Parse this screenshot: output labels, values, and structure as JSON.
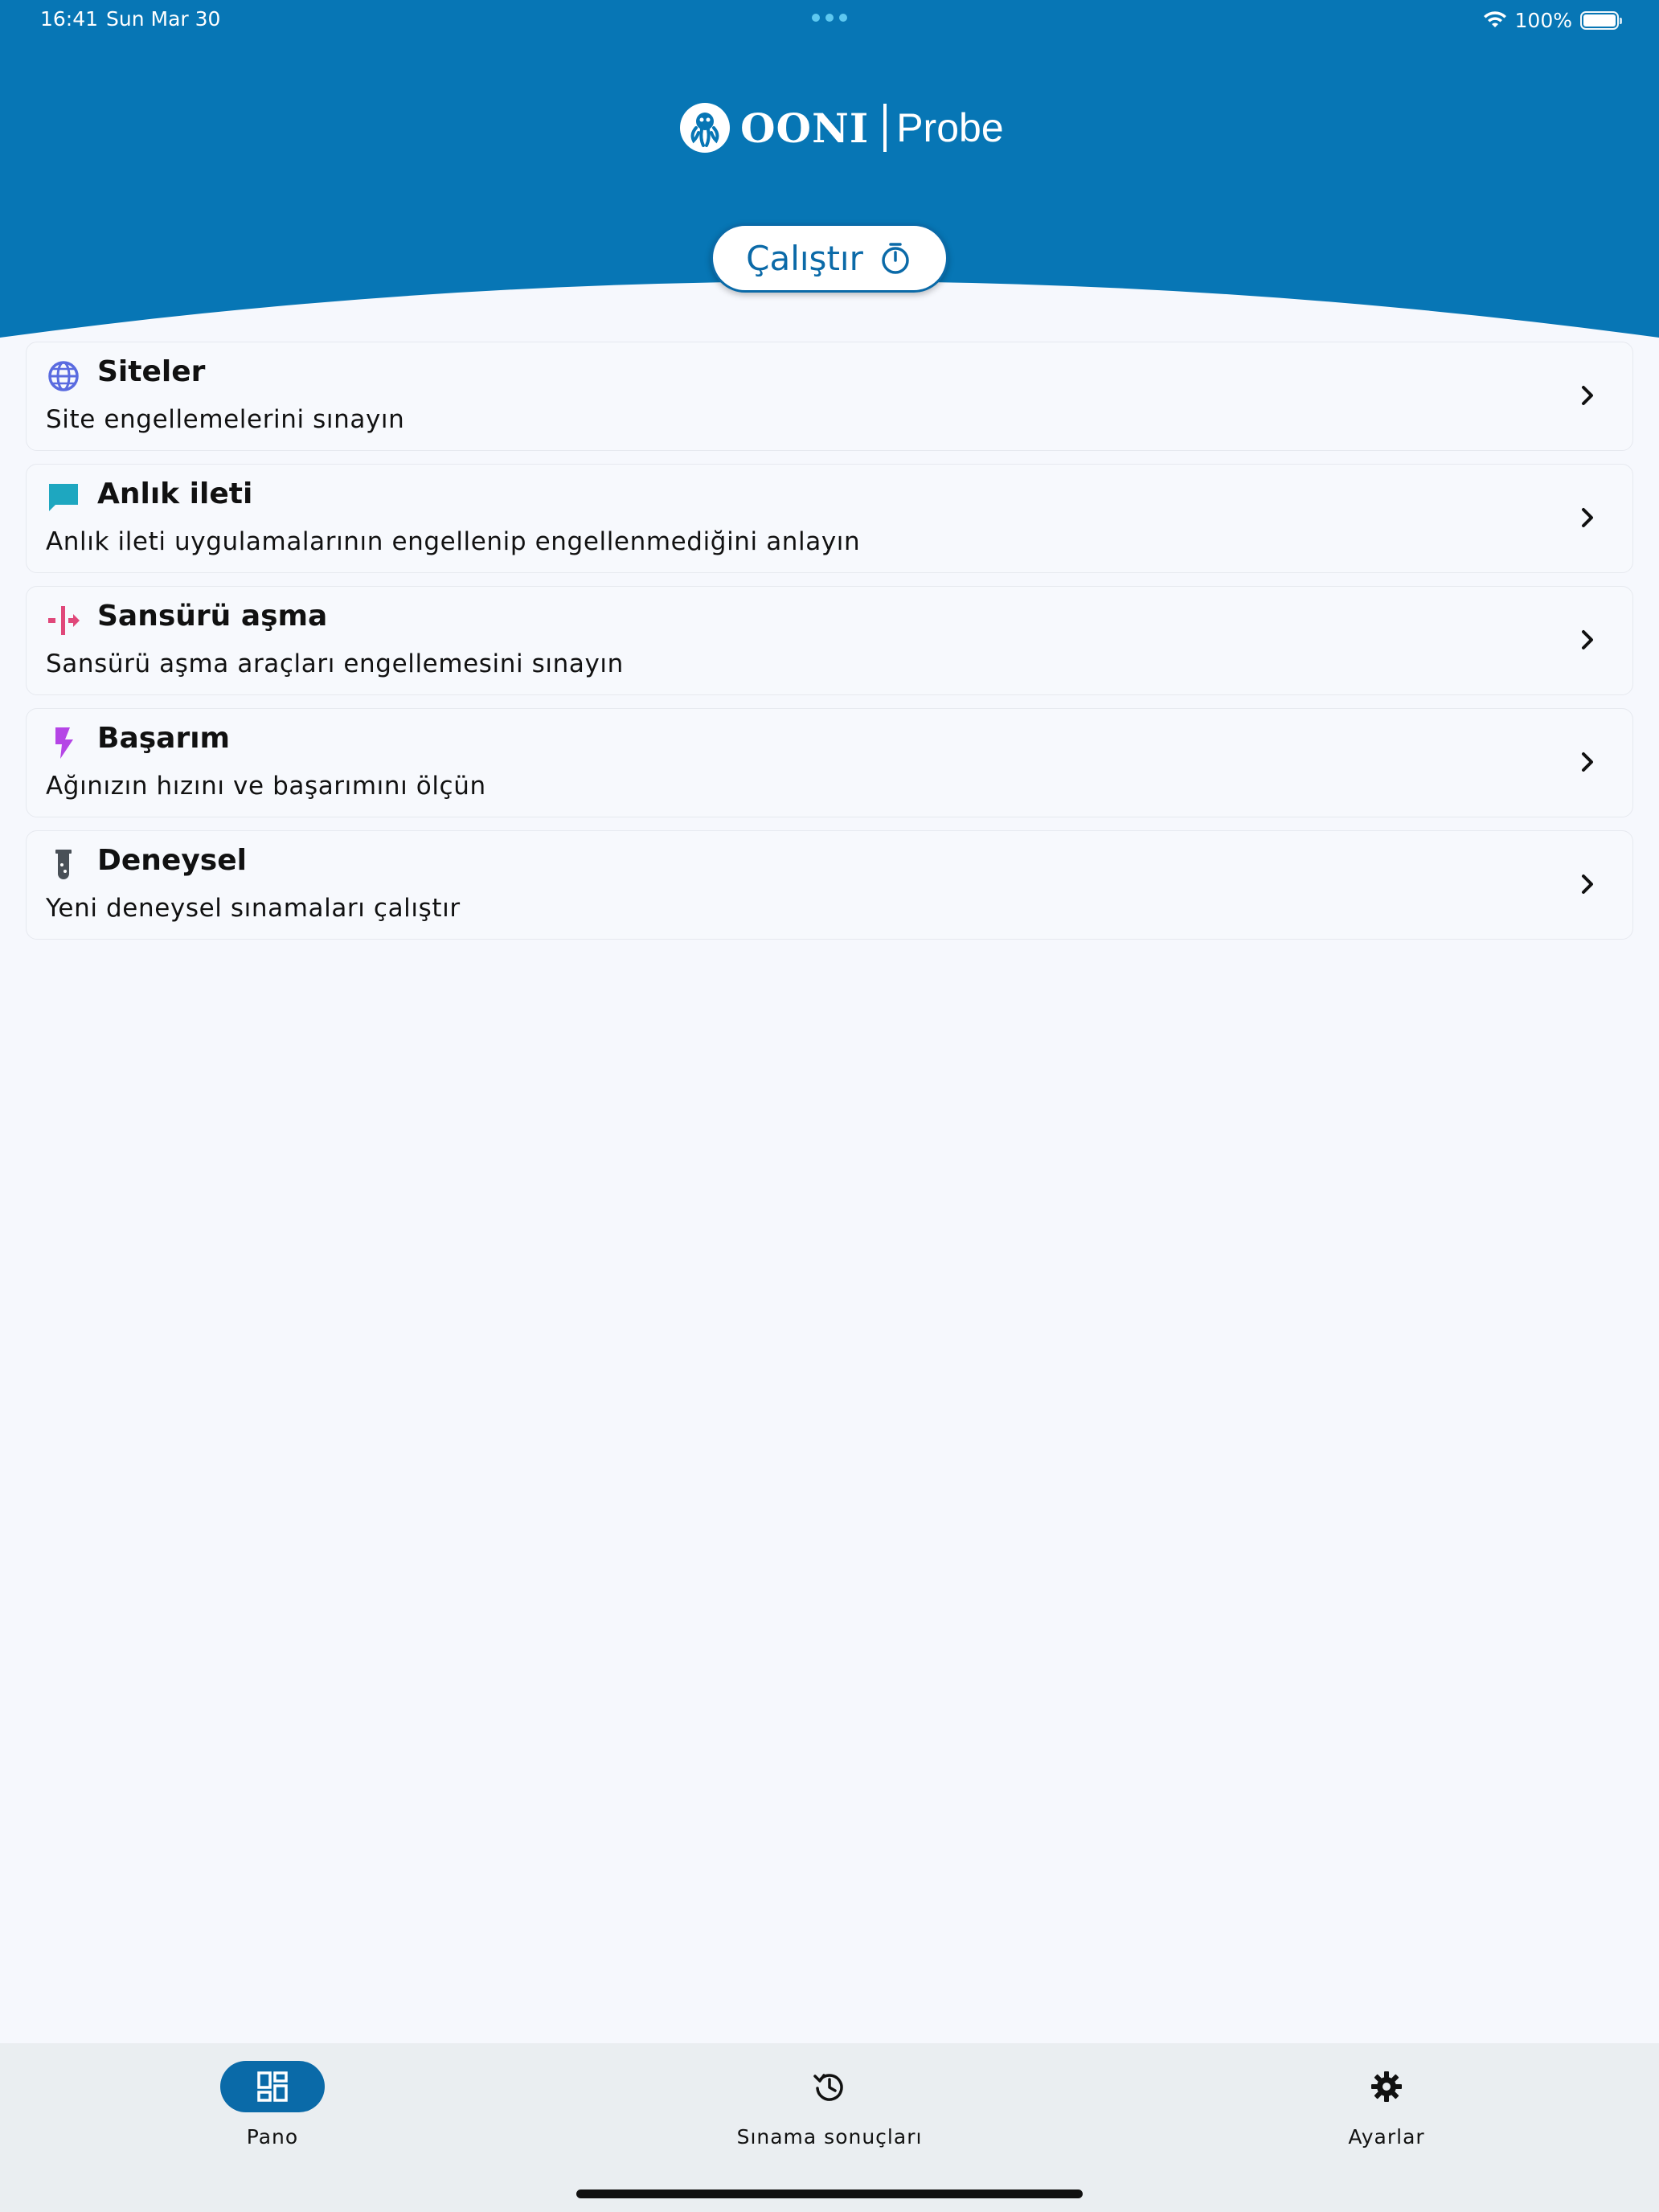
{
  "status_bar": {
    "time": "16:41",
    "date": "Sun Mar 30",
    "battery": "100%"
  },
  "header": {
    "logo_name": "OONI",
    "logo_product": "Probe",
    "run_button_label": "Çalıştır",
    "background_color": "#0776b5"
  },
  "tests": [
    {
      "title": "Siteler",
      "description": "Site engellemelerini sınayın",
      "icon": "globe-icon",
      "color": "#5a6be0"
    },
    {
      "title": "Anlık ileti",
      "description": "Anlık ileti uygulamalarının engellenip engellenmediğini anlayın",
      "icon": "chat-bubble-icon",
      "color": "#1ea7c0"
    },
    {
      "title": "Sansürü aşma",
      "description": "Sansürü aşma araçları engellemesini sınayın",
      "icon": "circumvention-icon",
      "color": "#e0487a"
    },
    {
      "title": "Başarım",
      "description": "Ağınızın hızını ve başarımını ölçün",
      "icon": "lightning-icon",
      "color": "#b545e6"
    },
    {
      "title": "Deneysel",
      "description": "Yeni deneysel sınamaları çalıştır",
      "icon": "test-tube-icon",
      "color": "#495057"
    }
  ],
  "tab_bar": {
    "tabs": [
      {
        "label": "Pano",
        "icon": "dashboard-icon",
        "active": true
      },
      {
        "label": "Sınama sonuçları",
        "icon": "history-icon",
        "active": false
      },
      {
        "label": "Ayarlar",
        "icon": "gear-icon",
        "active": false
      }
    ]
  }
}
